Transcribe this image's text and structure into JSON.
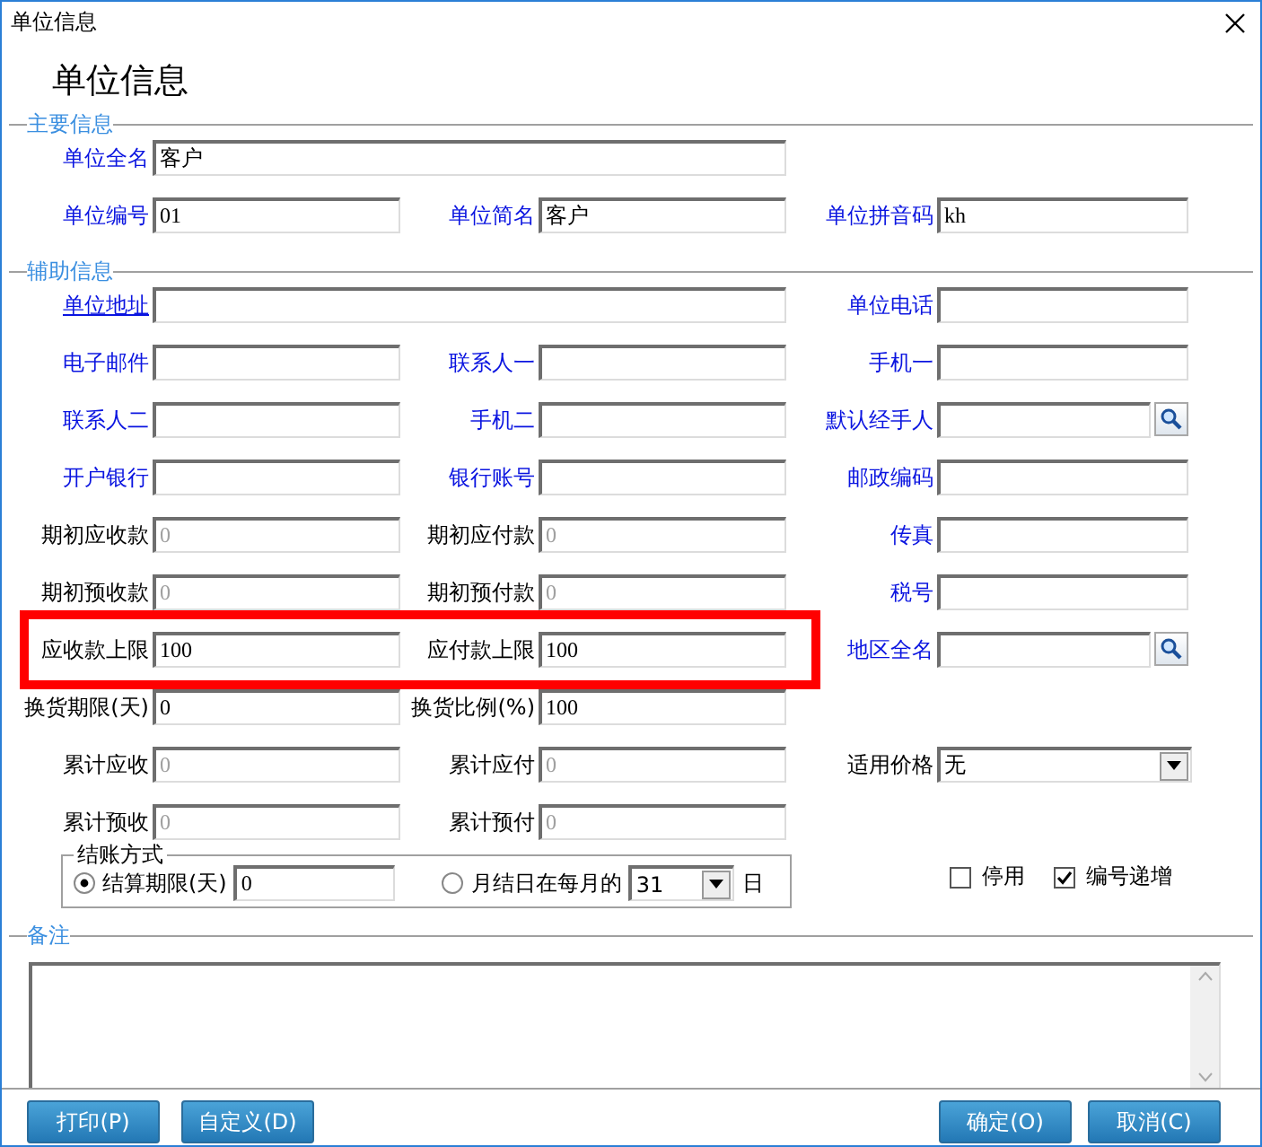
{
  "window": {
    "title": "单位信息"
  },
  "heading": "单位信息",
  "sections": [
    {
      "legend": "主要信息",
      "rows": [
        {
          "highlighted": false,
          "left": {
            "label": "单位全名",
            "link": true,
            "underlined": false,
            "kind": "text",
            "value": "客户",
            "disabled": false
          }
        },
        {
          "highlighted": false,
          "left": {
            "label": "单位编号",
            "link": true,
            "underlined": false,
            "kind": "text",
            "value": "01",
            "disabled": false
          },
          "middle": {
            "label": "单位简名",
            "link": true,
            "underlined": false,
            "kind": "text",
            "value": "客户",
            "disabled": false
          },
          "right": {
            "label": "单位拼音码",
            "link": true,
            "underlined": false,
            "kind": "text",
            "value": "kh",
            "disabled": false
          }
        }
      ]
    },
    {
      "legend": "辅助信息",
      "rows": [
        {
          "highlighted": false,
          "left": {
            "label": "单位地址",
            "link": true,
            "underlined": true,
            "kind": "text",
            "disabled": false
          },
          "right": {
            "label": "单位电话",
            "link": true,
            "underlined": false,
            "kind": "text",
            "disabled": false
          }
        },
        {
          "highlighted": false,
          "left": {
            "label": "电子邮件",
            "link": true,
            "underlined": false,
            "kind": "text",
            "disabled": false
          },
          "middle": {
            "label": "联系人一",
            "link": true,
            "underlined": false,
            "kind": "text",
            "disabled": false
          },
          "right": {
            "label": "手机一",
            "link": true,
            "underlined": false,
            "kind": "text",
            "disabled": false
          }
        },
        {
          "highlighted": false,
          "left": {
            "label": "联系人二",
            "link": true,
            "underlined": false,
            "kind": "text",
            "disabled": false
          },
          "middle": {
            "label": "手机二",
            "link": true,
            "underlined": false,
            "kind": "text",
            "disabled": false
          },
          "right": {
            "label": "默认经手人",
            "link": true,
            "underlined": false,
            "kind": "lookup",
            "disabled": false
          }
        },
        {
          "highlighted": false,
          "left": {
            "label": "开户银行",
            "link": true,
            "underlined": false,
            "kind": "text",
            "disabled": false
          },
          "middle": {
            "label": "银行账号",
            "link": true,
            "underlined": false,
            "kind": "text",
            "disabled": false
          },
          "right": {
            "label": "邮政编码",
            "link": true,
            "underlined": false,
            "kind": "text",
            "disabled": false
          }
        },
        {
          "highlighted": false,
          "left": {
            "label": "期初应收款",
            "link": false,
            "underlined": false,
            "kind": "text",
            "value": "0",
            "disabled": true
          },
          "middle": {
            "label": "期初应付款",
            "link": false,
            "underlined": false,
            "kind": "text",
            "value": "0",
            "disabled": true
          },
          "right": {
            "label": "传真",
            "link": true,
            "underlined": false,
            "kind": "text",
            "disabled": false
          }
        },
        {
          "highlighted": false,
          "left": {
            "label": "期初预收款",
            "link": false,
            "underlined": false,
            "kind": "text",
            "value": "0",
            "disabled": true
          },
          "middle": {
            "label": "期初预付款",
            "link": false,
            "underlined": false,
            "kind": "text",
            "value": "0",
            "disabled": true
          },
          "right": {
            "label": "税号",
            "link": true,
            "underlined": false,
            "kind": "text",
            "disabled": false
          }
        },
        {
          "highlighted": true,
          "left": {
            "label": "应收款上限",
            "link": false,
            "underlined": false,
            "kind": "text",
            "value": "100",
            "disabled": false
          },
          "middle": {
            "label": "应付款上限",
            "link": false,
            "underlined": false,
            "kind": "text",
            "value": "100",
            "disabled": false
          },
          "right": {
            "label": "地区全名",
            "link": true,
            "underlined": false,
            "kind": "lookup",
            "disabled": false
          }
        },
        {
          "highlighted": false,
          "left": {
            "label": "换货期限(天)",
            "link": false,
            "underlined": false,
            "kind": "text",
            "value": "0",
            "disabled": false
          },
          "middle": {
            "label": "换货比例(%)",
            "link": false,
            "underlined": false,
            "kind": "text",
            "value": "100",
            "disabled": false
          }
        },
        {
          "highlighted": false,
          "left": {
            "label": "累计应收",
            "link": false,
            "underlined": false,
            "kind": "text",
            "value": "0",
            "disabled": true
          },
          "middle": {
            "label": "累计应付",
            "link": false,
            "underlined": false,
            "kind": "text",
            "value": "0",
            "disabled": true
          },
          "right": {
            "label": "适用价格",
            "link": false,
            "underlined": false,
            "kind": "select",
            "value": "无",
            "disabled": false
          }
        },
        {
          "highlighted": false,
          "left": {
            "label": "累计预收",
            "link": false,
            "underlined": false,
            "kind": "text",
            "value": "0",
            "disabled": true
          },
          "middle": {
            "label": "累计预付",
            "link": false,
            "underlined": false,
            "kind": "text",
            "value": "0",
            "disabled": true
          }
        }
      ]
    }
  ],
  "settlement": {
    "legend": "结账方式",
    "options": [
      {
        "label": "结算期限(天)",
        "selected": true,
        "kind": "text",
        "value": "0"
      },
      {
        "label": "月结日在每月的",
        "selected": false,
        "kind": "select",
        "value": "31",
        "suffix": "日"
      }
    ]
  },
  "checkboxes": [
    {
      "label": "停用",
      "checked": false
    },
    {
      "label": "编号递增",
      "checked": true
    }
  ],
  "notes": {
    "legend": "备注"
  },
  "buttons": {
    "left": [
      {
        "label": "打印(P)"
      },
      {
        "label": "自定义(D)"
      }
    ],
    "right": [
      {
        "label": "确定(O)"
      },
      {
        "label": "取消(C)"
      }
    ]
  }
}
